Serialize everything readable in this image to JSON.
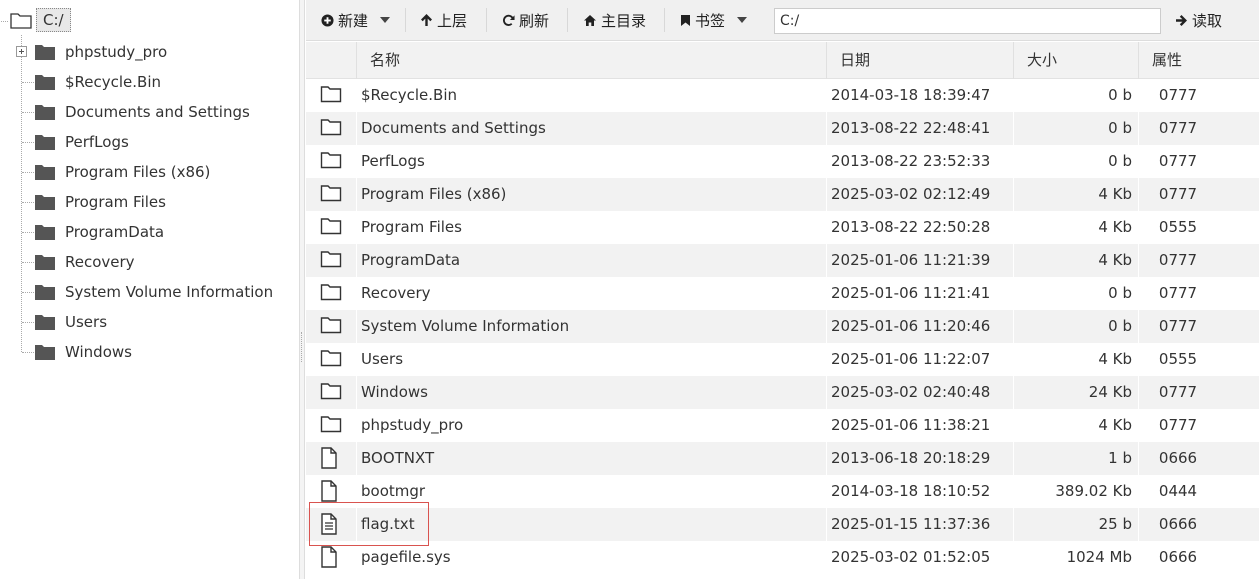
{
  "tree": {
    "root_label": "C:/",
    "items": [
      {
        "label": "phpstudy_pro",
        "expandable": true
      },
      {
        "label": "$Recycle.Bin",
        "expandable": false
      },
      {
        "label": "Documents and Settings",
        "expandable": false
      },
      {
        "label": "PerfLogs",
        "expandable": false
      },
      {
        "label": "Program Files (x86)",
        "expandable": false
      },
      {
        "label": "Program Files",
        "expandable": false
      },
      {
        "label": "ProgramData",
        "expandable": false
      },
      {
        "label": "Recovery",
        "expandable": false
      },
      {
        "label": "System Volume Information",
        "expandable": false
      },
      {
        "label": "Users",
        "expandable": false
      },
      {
        "label": "Windows",
        "expandable": false
      }
    ]
  },
  "toolbar": {
    "new_label": "新建",
    "up_label": "上层",
    "refresh_label": "刷新",
    "home_label": "主目录",
    "bookmark_label": "书签",
    "path_value": "C:/",
    "read_label": "读取"
  },
  "table": {
    "headers": {
      "name": "名称",
      "date": "日期",
      "size": "大小",
      "attr": "属性"
    },
    "rows": [
      {
        "type": "folder",
        "name": "$Recycle.Bin",
        "date": "2014-03-18 18:39:47",
        "size": "0 b",
        "attr": "0777"
      },
      {
        "type": "folder",
        "name": "Documents and Settings",
        "date": "2013-08-22 22:48:41",
        "size": "0 b",
        "attr": "0777"
      },
      {
        "type": "folder",
        "name": "PerfLogs",
        "date": "2013-08-22 23:52:33",
        "size": "0 b",
        "attr": "0777"
      },
      {
        "type": "folder",
        "name": "Program Files (x86)",
        "date": "2025-03-02 02:12:49",
        "size": "4 Kb",
        "attr": "0777"
      },
      {
        "type": "folder",
        "name": "Program Files",
        "date": "2013-08-22 22:50:28",
        "size": "4 Kb",
        "attr": "0555"
      },
      {
        "type": "folder",
        "name": "ProgramData",
        "date": "2025-01-06 11:21:39",
        "size": "4 Kb",
        "attr": "0777"
      },
      {
        "type": "folder",
        "name": "Recovery",
        "date": "2025-01-06 11:21:41",
        "size": "0 b",
        "attr": "0777"
      },
      {
        "type": "folder",
        "name": "System Volume Information",
        "date": "2025-01-06 11:20:46",
        "size": "0 b",
        "attr": "0777"
      },
      {
        "type": "folder",
        "name": "Users",
        "date": "2025-01-06 11:22:07",
        "size": "4 Kb",
        "attr": "0555"
      },
      {
        "type": "folder",
        "name": "Windows",
        "date": "2025-03-02 02:40:48",
        "size": "24 Kb",
        "attr": "0777"
      },
      {
        "type": "folder",
        "name": "phpstudy_pro",
        "date": "2025-01-06 11:38:21",
        "size": "4 Kb",
        "attr": "0777"
      },
      {
        "type": "file",
        "name": "BOOTNXT",
        "date": "2013-06-18 20:18:29",
        "size": "1 b",
        "attr": "0666"
      },
      {
        "type": "file",
        "name": "bootmgr",
        "date": "2014-03-18 18:10:52",
        "size": "389.02 Kb",
        "attr": "0444"
      },
      {
        "type": "text-file",
        "name": "flag.txt",
        "date": "2025-01-15 11:37:36",
        "size": "25 b",
        "attr": "0666"
      },
      {
        "type": "file",
        "name": "pagefile.sys",
        "date": "2025-03-02 01:52:05",
        "size": "1024 Mb",
        "attr": "0666"
      }
    ]
  },
  "highlight_color": "#d9534f"
}
